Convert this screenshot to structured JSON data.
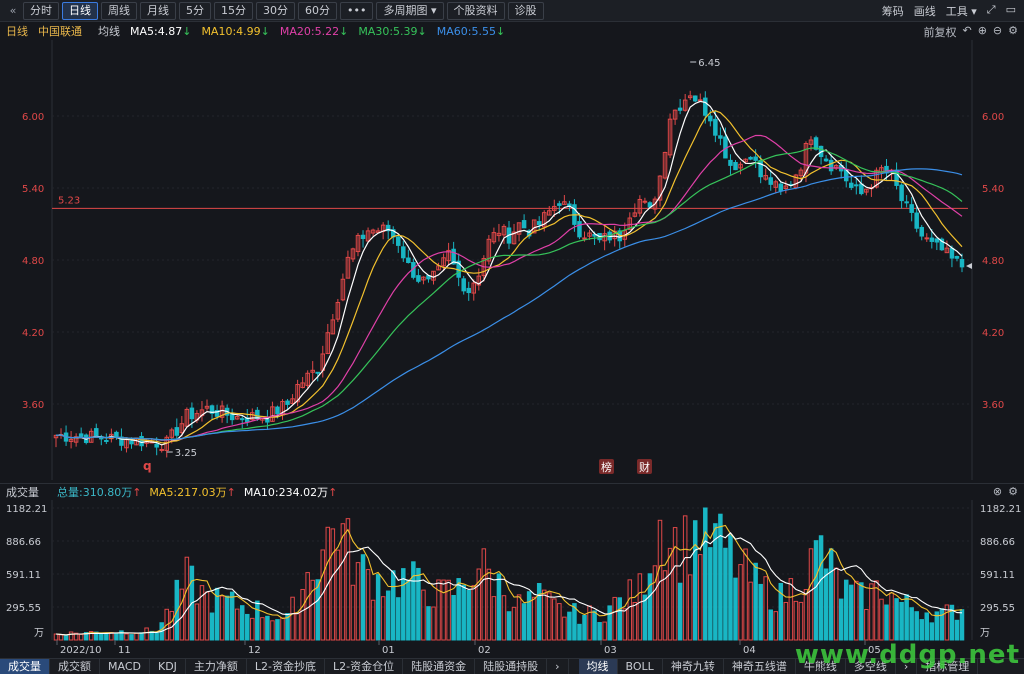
{
  "toolbar": {
    "back_icon": "double-chevron-left-icon",
    "periods": [
      "分时",
      "日线",
      "周线",
      "月线",
      "5分",
      "15分",
      "30分",
      "60分"
    ],
    "active_period": "日线",
    "more": "•••",
    "multi_period": "多周期图",
    "stock_info": "个股资料",
    "diagnose": "诊股",
    "right": [
      "筹码",
      "画线",
      "工具"
    ]
  },
  "legend": {
    "period": "日线",
    "stock": "中国联通",
    "ma_label": "均线",
    "ma5": "MA5:4.87",
    "ma10": "MA10:4.99",
    "ma20": "MA20:5.22",
    "ma30": "MA30:5.39",
    "ma60": "MA60:5.55",
    "adjust": "前复权",
    "colors": {
      "ma5": "#ffffff",
      "ma10": "#f2c12e",
      "ma20": "#e040a8",
      "ma30": "#36c35a",
      "ma60": "#3b8fe8"
    }
  },
  "price_chart": {
    "y_ticks": [
      "6.00",
      "5.40",
      "4.80",
      "4.20",
      "3.60"
    ],
    "ref_line_label": "5.23",
    "high_label": "6.45",
    "low_label": "3.25",
    "markers": [
      "榜",
      "财"
    ]
  },
  "volume_head": {
    "title": "成交量",
    "total": "总量:310.80万",
    "ma5": "MA5:217.03万",
    "ma10": "MA10:234.02万"
  },
  "volume_chart": {
    "y_ticks": [
      "1182.21",
      "886.66",
      "591.11",
      "295.55"
    ],
    "unit": "万",
    "x_labels": [
      "2022/10",
      "11",
      "12",
      "01",
      "02",
      "03",
      "04",
      "05"
    ]
  },
  "tabs": {
    "left": [
      "成交量",
      "成交额",
      "MACD",
      "KDJ",
      "主力净额",
      "L2-资金抄底",
      "L2-资金仓位",
      "陆股通资金",
      "陆股通持股"
    ],
    "right": [
      "均线",
      "BOLL",
      "神奇九转",
      "神奇五线谱",
      "牛熊线",
      "多空线",
      "指标管理"
    ],
    "watermark": "www.ddgp.net"
  },
  "chart_data": {
    "type": "candlestick",
    "title": "中国联通 日线",
    "ylim": [
      3.2,
      6.5
    ],
    "y_ticks": [
      3.6,
      4.2,
      4.8,
      5.4,
      6.0
    ],
    "reference_line": 5.23,
    "highest": 6.45,
    "lowest": 3.25,
    "last_ma": {
      "MA5": 4.87,
      "MA10": 4.99,
      "MA20": 5.22,
      "MA30": 5.39,
      "MA60": 5.55
    },
    "close_path": [
      [
        0,
        3.34
      ],
      [
        6,
        3.33
      ],
      [
        12,
        3.31
      ],
      [
        18,
        3.29
      ],
      [
        22,
        3.27
      ],
      [
        26,
        3.5
      ],
      [
        30,
        3.56
      ],
      [
        36,
        3.49
      ],
      [
        42,
        3.5
      ],
      [
        46,
        3.6
      ],
      [
        48,
        3.75
      ],
      [
        52,
        3.9
      ],
      [
        54,
        4.2
      ],
      [
        56,
        4.5
      ],
      [
        58,
        4.8
      ],
      [
        60,
        4.95
      ],
      [
        62,
        5.05
      ],
      [
        66,
        5.05
      ],
      [
        68,
        4.95
      ],
      [
        70,
        4.75
      ],
      [
        72,
        4.65
      ],
      [
        74,
        4.6
      ],
      [
        76,
        4.7
      ],
      [
        78,
        4.85
      ],
      [
        80,
        4.65
      ],
      [
        82,
        4.55
      ],
      [
        84,
        4.7
      ],
      [
        86,
        4.95
      ],
      [
        88,
        5.05
      ],
      [
        90,
        5.0
      ],
      [
        92,
        5.1
      ],
      [
        94,
        5.05
      ],
      [
        96,
        5.1
      ],
      [
        98,
        5.2
      ],
      [
        100,
        5.3
      ],
      [
        102,
        5.2
      ],
      [
        104,
        5.05
      ],
      [
        106,
        5.0
      ],
      [
        108,
        4.95
      ],
      [
        110,
        5.0
      ],
      [
        112,
        5.0
      ],
      [
        114,
        5.2
      ],
      [
        116,
        5.3
      ],
      [
        118,
        5.2
      ],
      [
        120,
        5.5
      ],
      [
        122,
        6.0
      ],
      [
        124,
        6.1
      ],
      [
        126,
        6.2
      ],
      [
        128,
        6.1
      ],
      [
        130,
        6.0
      ],
      [
        132,
        5.8
      ],
      [
        134,
        5.6
      ],
      [
        136,
        5.6
      ],
      [
        138,
        5.7
      ],
      [
        140,
        5.5
      ],
      [
        142,
        5.45
      ],
      [
        144,
        5.35
      ],
      [
        146,
        5.45
      ],
      [
        148,
        5.6
      ],
      [
        150,
        5.85
      ],
      [
        152,
        5.7
      ],
      [
        154,
        5.6
      ],
      [
        156,
        5.55
      ],
      [
        158,
        5.4
      ],
      [
        160,
        5.35
      ],
      [
        162,
        5.45
      ],
      [
        164,
        5.55
      ],
      [
        166,
        5.5
      ],
      [
        168,
        5.3
      ],
      [
        170,
        5.15
      ],
      [
        172,
        5.0
      ],
      [
        174,
        4.92
      ],
      [
        176,
        4.88
      ],
      [
        178,
        4.8
      ],
      [
        180,
        4.75
      ]
    ],
    "volume_ylim": [
      0,
      1182.21
    ],
    "volume_path": [
      [
        0,
        60
      ],
      [
        10,
        80
      ],
      [
        20,
        90
      ],
      [
        26,
        600
      ],
      [
        30,
        420
      ],
      [
        40,
        300
      ],
      [
        46,
        200
      ],
      [
        50,
        650
      ],
      [
        54,
        1000
      ],
      [
        56,
        1182
      ],
      [
        58,
        900
      ],
      [
        60,
        700
      ],
      [
        64,
        600
      ],
      [
        70,
        600
      ],
      [
        76,
        450
      ],
      [
        80,
        500
      ],
      [
        84,
        750
      ],
      [
        88,
        550
      ],
      [
        92,
        350
      ],
      [
        96,
        420
      ],
      [
        100,
        300
      ],
      [
        104,
        250
      ],
      [
        108,
        260
      ],
      [
        112,
        380
      ],
      [
        116,
        500
      ],
      [
        120,
        1182
      ],
      [
        124,
        900
      ],
      [
        128,
        1100
      ],
      [
        132,
        950
      ],
      [
        136,
        700
      ],
      [
        140,
        520
      ],
      [
        144,
        420
      ],
      [
        148,
        600
      ],
      [
        152,
        900
      ],
      [
        156,
        500
      ],
      [
        160,
        420
      ],
      [
        164,
        520
      ],
      [
        168,
        360
      ],
      [
        172,
        300
      ],
      [
        176,
        250
      ],
      [
        180,
        310
      ]
    ],
    "volume_ma5_last": 217.03,
    "volume_ma10_last": 234.02
  }
}
